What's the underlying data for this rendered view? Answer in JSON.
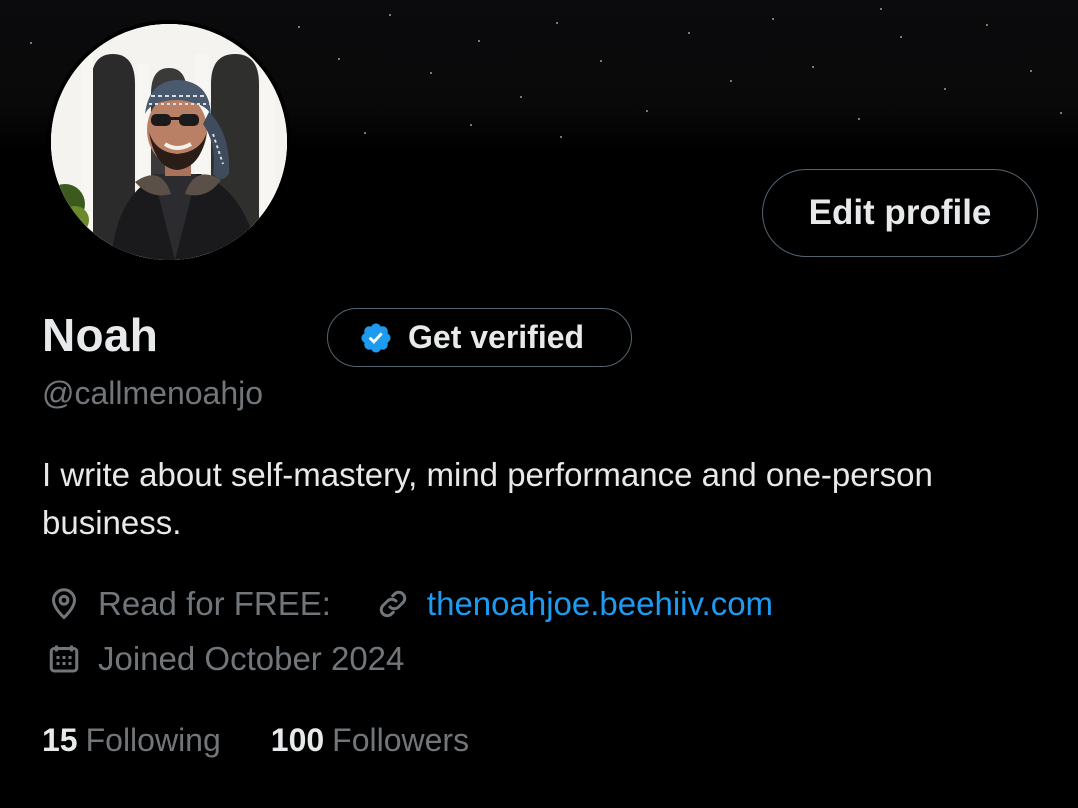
{
  "profile": {
    "name": "Noah",
    "handle": "@callmenoahjo",
    "bio": "I write about self-mastery, mind performance and one-person business.",
    "location": "Read for FREE:",
    "website": "thenoahjoe.beehiiv.com",
    "joined": "Joined October 2024"
  },
  "actions": {
    "edit_profile_label": "Edit profile",
    "get_verified_label": "Get verified"
  },
  "stats": {
    "following_count": "15",
    "following_label": "Following",
    "followers_count": "100",
    "followers_label": "Followers"
  },
  "icons": {
    "verified": "verified-badge-icon",
    "location": "location-pin-icon",
    "link": "link-icon",
    "calendar": "calendar-icon"
  },
  "colors": {
    "background": "#000000",
    "text_primary": "#e7e9ea",
    "text_secondary": "#71767b",
    "accent": "#1d9bf0",
    "border": "#536471"
  }
}
